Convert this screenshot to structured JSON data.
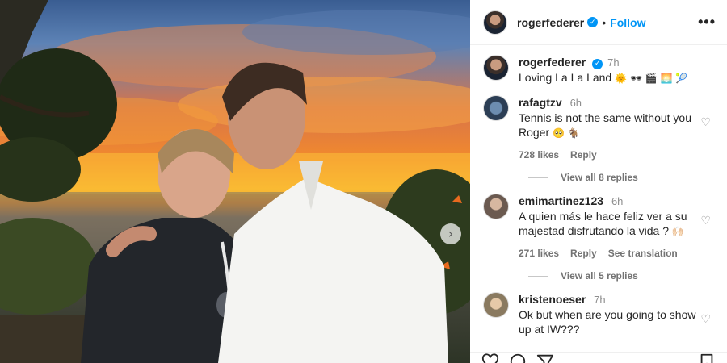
{
  "post": {
    "username": "rogerfederer",
    "follow_label": "Follow",
    "separator": "•",
    "more_icon": "more-options-icon",
    "caption": {
      "username": "rogerfederer",
      "time": "7h",
      "text": "Loving La La Land",
      "emojis": "🌞 🕶 🎬 🌅 🎾"
    }
  },
  "photo": {
    "carousel_next_icon": "chevron-right-icon"
  },
  "comments": [
    {
      "username": "rafagtzv",
      "time": "6h",
      "text": "Tennis is not the same without you Roger",
      "emojis": "🥺 🐐",
      "likes": "728 likes",
      "reply_label": "Reply",
      "view_replies": "View all 8 replies"
    },
    {
      "username": "emimartinez123",
      "time": "6h",
      "text": "A quien más le hace feliz ver a su majestad disfrutando la vida ?",
      "emojis": "🙌🏻",
      "likes": "271 likes",
      "reply_label": "Reply",
      "translation_label": "See translation",
      "view_replies": "View all 5 replies"
    },
    {
      "username": "kristenoeser",
      "time": "7h",
      "text": "Ok but when are you going to show up at IW???"
    }
  ],
  "actions": {
    "like_icon": "heart-icon",
    "comment_icon": "comment-icon",
    "share_icon": "share-icon",
    "save_icon": "bookmark-icon"
  },
  "colors": {
    "accent": "#0095f6",
    "muted": "#737373"
  }
}
